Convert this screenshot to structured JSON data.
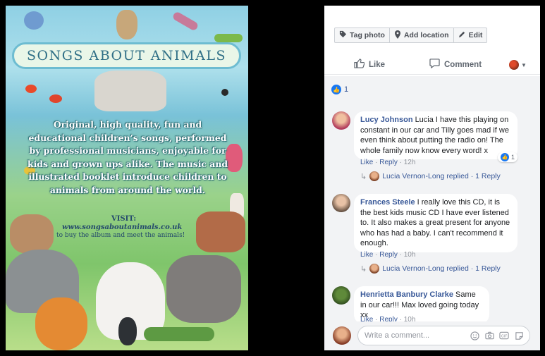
{
  "photo": {
    "title": "SONGS  ABOUT ANIMALS",
    "blurb": "Original, high quality, fun and educational children’s songs, performed by professional musicians, enjoyable for kids and grown ups alike. The music and illustrated booklet introduce children to animals from around the world.",
    "visit": "VISIT:",
    "url": "www.songsaboutanimals.co.uk",
    "tagline": "to buy the album and meet the animals!"
  },
  "toolbar": {
    "tag_photo": "Tag photo",
    "add_location": "Add location",
    "edit": "Edit"
  },
  "actions": {
    "like": "Like",
    "comment": "Comment"
  },
  "reactions": {
    "count": "1"
  },
  "comments": [
    {
      "name": "Lucy Johnson",
      "text": "Lucia I have this playing on constant in our car and Tilly goes mad if we even think about putting the radio on! The whole family now know every word! x",
      "like": "Like",
      "reply": "Reply",
      "time": "12h",
      "reaction_count": "1",
      "reply_summary": "Lucia Vernon-Long replied · 1 Reply"
    },
    {
      "name": "Frances Steele",
      "text": "I really love this CD, it is the best kids music CD I have ever listened to. It also makes a great present for anyone who has had a baby. I can't recommend it enough.",
      "like": "Like",
      "reply": "Reply",
      "time": "10h",
      "reply_summary": "Lucia Vernon-Long replied · 1 Reply"
    },
    {
      "name": "Henrietta Banbury Clarke",
      "text": "Same in our car!!! Max loved going today xx",
      "like": "Like",
      "reply": "Reply",
      "time": "10h"
    }
  ],
  "composer": {
    "placeholder": "Write a comment..."
  },
  "colors": {
    "link": "#385898",
    "like_blue": "#1877f2",
    "panel_bg": "#f2f3f5"
  }
}
